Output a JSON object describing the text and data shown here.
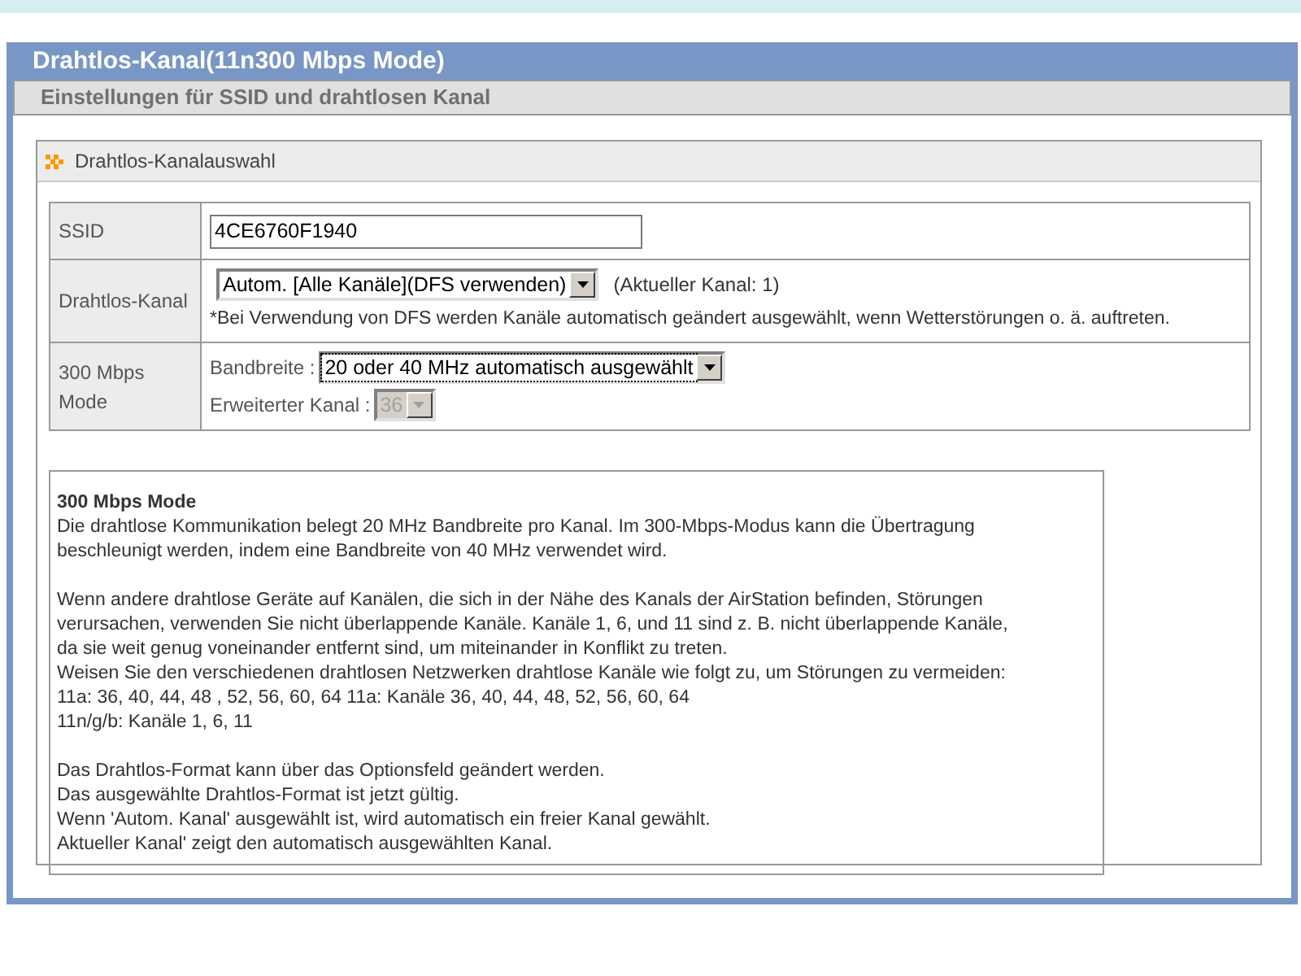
{
  "window": {
    "title": "Drahtlos-Kanal(11n300 Mbps Mode)"
  },
  "subheader": "Einstellungen für SSID und drahtlosen Kanal",
  "section": {
    "title": "Drahtlos-Kanalauswahl"
  },
  "rows": [
    {
      "label": "SSID",
      "kind": "text",
      "value": "4CE6760F1940"
    },
    {
      "label": "Drahtlos-Kanal",
      "kind": "channel",
      "select": {
        "value": "Autom. [Alle Kanäle](DFS verwenden)",
        "disabled": false,
        "focused": false
      },
      "current": "(Aktueller Kanal: 1)",
      "note": "*Bei Verwendung von DFS werden Kanäle automatisch geändert ausgewählt, wenn Wetterstörungen o. ä. auftreten."
    },
    {
      "label": "300 Mbps Mode",
      "kind": "mode",
      "fields": [
        {
          "label": "Bandbreite :",
          "select": {
            "value": "20 oder 40 MHz automatisch ausgewählt",
            "disabled": false,
            "focused": true
          }
        },
        {
          "label": "Erweiterter Kanal :",
          "select": {
            "value": "36",
            "disabled": true,
            "focused": false
          }
        }
      ]
    }
  ],
  "help": {
    "title": "300 Mbps Mode",
    "paragraphs": [
      [
        "Die drahtlose Kommunikation belegt 20 MHz Bandbreite pro Kanal. Im 300-Mbps-Modus kann die Übertragung",
        "beschleunigt werden, indem eine Bandbreite von 40 MHz verwendet wird."
      ],
      [
        "Wenn andere drahtlose Geräte auf Kanälen, die sich in der Nähe des Kanals der AirStation befinden, Störungen",
        "verursachen, verwenden Sie nicht überlappende Kanäle. Kanäle 1, 6, und 11 sind z. B. nicht überlappende Kanäle,",
        "da sie weit genug voneinander entfernt sind, um miteinander in Konflikt zu treten.",
        "Weisen Sie den verschiedenen drahtlosen Netzwerken drahtlose Kanäle wie folgt zu, um Störungen zu vermeiden:",
        "11a: 36, 40, 44, 48 , 52, 56, 60, 64 11a: Kanäle 36, 40, 44, 48, 52, 56, 60, 64",
        "11n/g/b: Kanäle 1, 6, 11"
      ],
      [
        "Das Drahtlos-Format kann über das Optionsfeld geändert werden.",
        "Das ausgewählte Drahtlos-Format ist jetzt gültig.",
        "Wenn 'Autom. Kanal' ausgewählt ist, wird automatisch ein freier Kanal gewählt.",
        "Aktueller Kanal' zeigt den automatisch ausgewählten Kanal."
      ]
    ]
  }
}
